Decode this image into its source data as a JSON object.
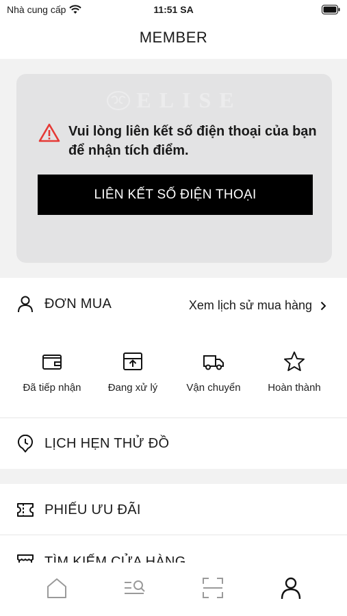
{
  "status_bar": {
    "carrier": "Nhà cung cấp",
    "time": "11:51 SA"
  },
  "header": {
    "title": "MEMBER"
  },
  "banner": {
    "logo_text": "ELISE",
    "warning": "Vui lòng liên kết số điện thoại của bạn để nhận tích điểm.",
    "button_label": "LIÊN KẾT SỐ ĐIỆN THOẠI"
  },
  "orders": {
    "title": "ĐƠN MUA",
    "history_link": "Xem lịch sử mua hàng",
    "statuses": [
      {
        "label": "Đã tiếp nhận",
        "icon": "wallet-icon"
      },
      {
        "label": "Đang xử lý",
        "icon": "box-upload-icon"
      },
      {
        "label": "Vận chuyển",
        "icon": "truck-icon"
      },
      {
        "label": "Hoàn thành",
        "icon": "star-icon"
      }
    ]
  },
  "menu": {
    "appointment": "LỊCH HẸN THỬ ĐỒ",
    "coupons": "PHIẾU ƯU ĐÃI",
    "stores": "TÌM KIẾM CỬA HÀNG"
  },
  "tabbar": {
    "tabs": [
      "home-icon",
      "search-list-icon",
      "scan-icon",
      "profile-icon"
    ],
    "active": "profile-icon"
  },
  "colors": {
    "accent": "#000000",
    "warning": "#e53935",
    "card": "#e3e3e4",
    "background_band": "#f2f2f2"
  }
}
